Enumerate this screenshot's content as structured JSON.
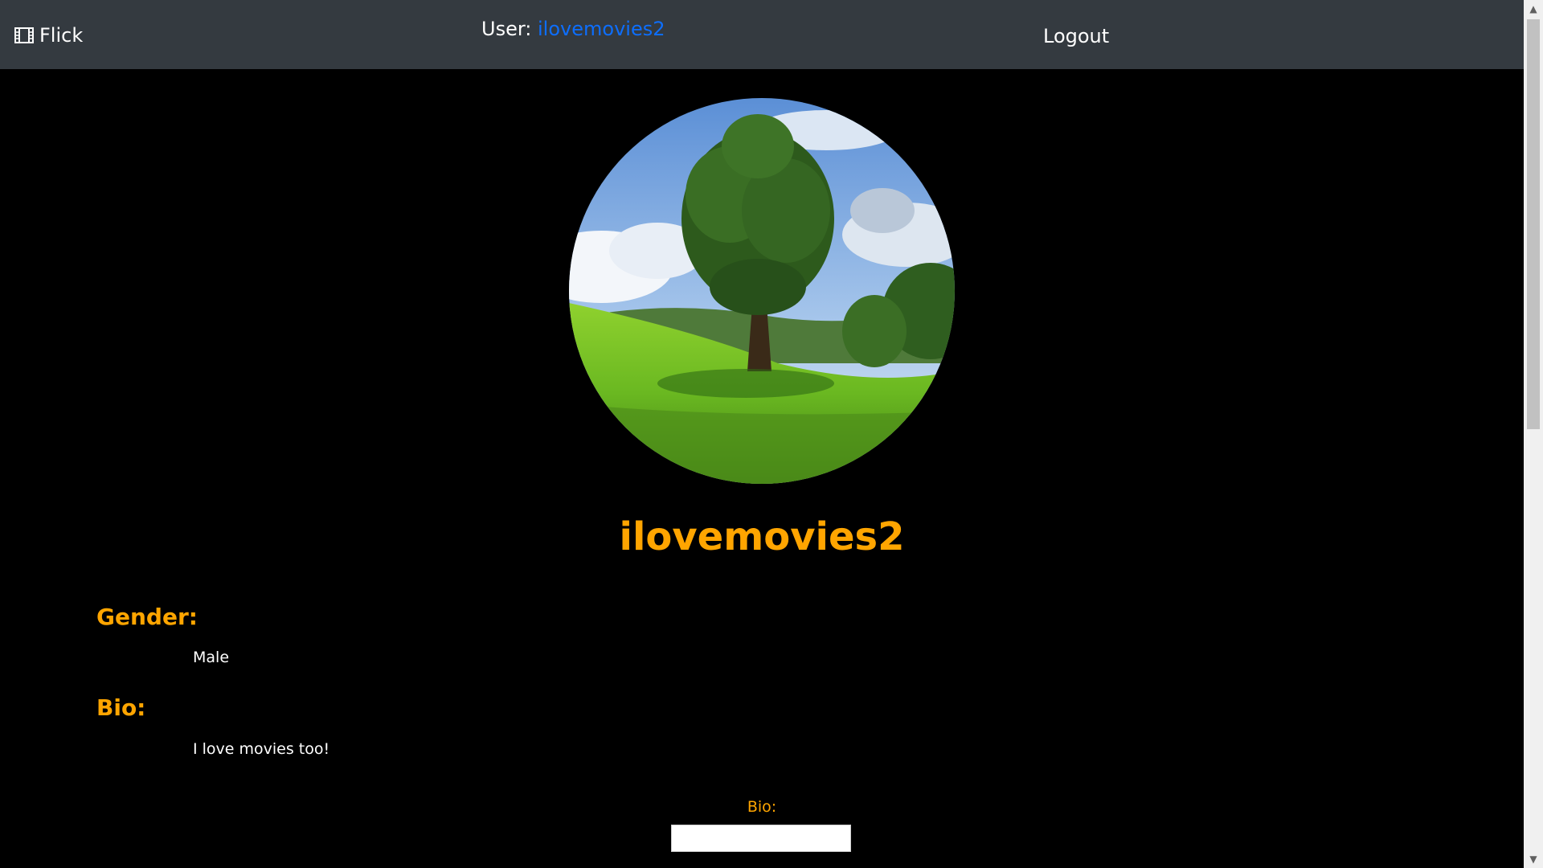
{
  "navbar": {
    "brand_label": "Flick",
    "brand_icon": "film-icon",
    "user_prefix": "User:",
    "username": "ilovemovies2",
    "logout_label": "Logout",
    "user_link_color": "#0d6efd",
    "background_color": "#343a40"
  },
  "profile": {
    "avatar_icon": "profile-picture-tree-landscape",
    "name": "ilovemovies2",
    "gender_heading": "Gender:",
    "gender_value": "Male",
    "bio_heading": "Bio:",
    "bio_value": "I love movies too!",
    "accent_color": "#ffa500"
  },
  "edit_form": {
    "bio_label": "Bio:",
    "bio_input_value": ""
  }
}
